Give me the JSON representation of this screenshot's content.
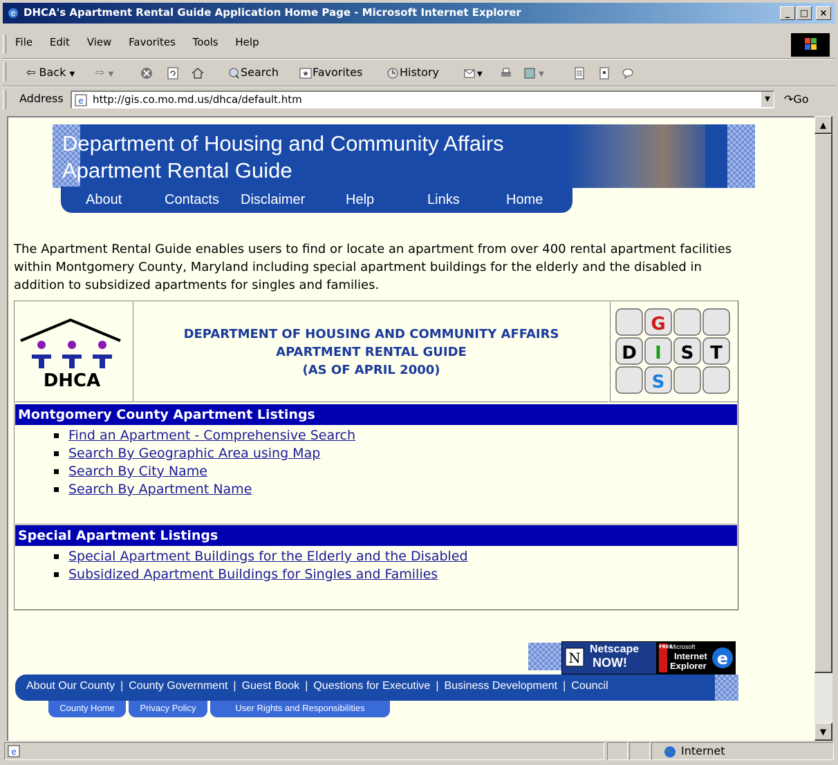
{
  "window": {
    "title": "DHCA's Apartment Rental Guide Application Home Page - Microsoft Internet Explorer",
    "minimize": "_",
    "maximize": "□",
    "close": "×"
  },
  "menu": [
    "File",
    "Edit",
    "View",
    "Favorites",
    "Tools",
    "Help"
  ],
  "toolbar": {
    "back": "Back",
    "search": "Search",
    "favorites": "Favorites",
    "history": "History"
  },
  "address": {
    "label": "Address",
    "url": "http://gis.co.mo.md.us/dhca/default.htm",
    "go": "Go"
  },
  "banner": {
    "line1": "Department of Housing and Community Affairs",
    "line2": "Apartment Rental Guide"
  },
  "nav": [
    "About",
    "Contacts",
    "Disclaimer",
    "Help",
    "Links",
    "Home"
  ],
  "intro": "The Apartment Rental Guide enables users to find or locate an apartment from over 400 rental apartment facilities within Montgomery County, Maryland including special apartment buildings for the elderly and the disabled in addition to subsidized apartments for singles and families.",
  "logo": {
    "text": "DHCA"
  },
  "header": {
    "line1": "DEPARTMENT OF HOUSING AND COMMUNITY AFFAIRS",
    "line2": "APARTMENT RENTAL GUIDE",
    "line3": "(AS OF APRIL 2000)"
  },
  "gis_logo": {
    "g": "G",
    "d": "D",
    "i": "I",
    "s": "S",
    "t": "T",
    "s2": "S"
  },
  "sections": {
    "montgomery": {
      "title": "Montgomery County Apartment Listings",
      "links": [
        "Find an Apartment - Comprehensive Search",
        "Search By Geographic Area using Map",
        "Search By City Name",
        "Search By Apartment Name"
      ]
    },
    "special": {
      "title": "Special Apartment Listings",
      "links": [
        "Special Apartment Buildings for the Elderly and the Disabled",
        "Subsidized Apartment Buildings for Singles and Families"
      ]
    }
  },
  "badges": {
    "netscape_line1": "Netscape",
    "netscape_line2": "NOW!",
    "ie_line1": "Microsoft",
    "ie_line2": "Internet",
    "ie_line3": "Explorer",
    "ie_free": "FREE"
  },
  "footer": {
    "links": [
      "About Our County",
      "County Government",
      "Guest Book",
      "Questions for Executive",
      "Business Development",
      "Council"
    ],
    "sub": [
      "County Home",
      "Privacy Policy",
      "User Rights and Responsibilities"
    ]
  },
  "status": {
    "zone": "Internet"
  }
}
